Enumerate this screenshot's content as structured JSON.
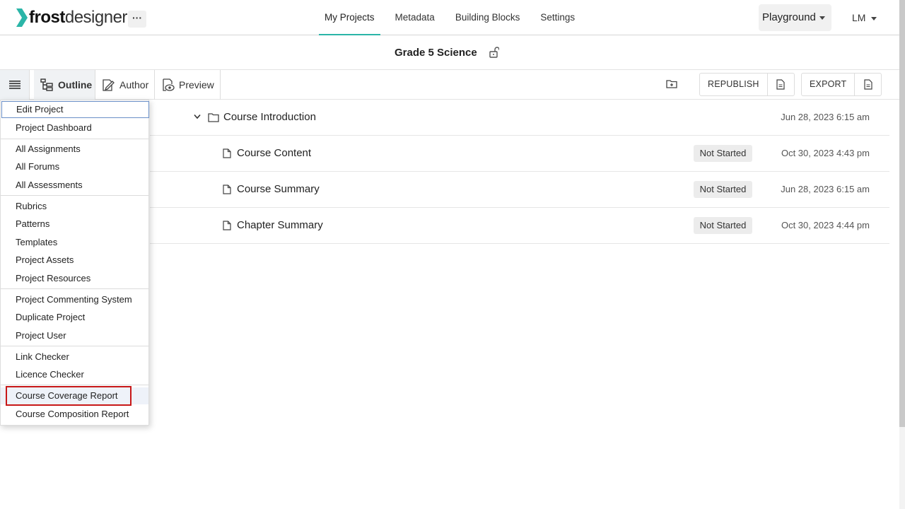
{
  "header": {
    "logo_bold": "frost",
    "logo_light": "designer",
    "more_label": "···",
    "nav": [
      {
        "label": "My Projects"
      },
      {
        "label": "Metadata"
      },
      {
        "label": "Building Blocks"
      },
      {
        "label": "Settings"
      }
    ],
    "workspace": "Playground",
    "user_initials": "LM",
    "accent_color": "#2bb5a8"
  },
  "project": {
    "title": "Grade 5 Science",
    "lock_icon": "unlock-icon"
  },
  "toolbar": {
    "outline_label": "Outline",
    "author_label": "Author",
    "preview_label": "Preview",
    "republish_label": "REPUBLISH",
    "export_label": "EXPORT"
  },
  "outline": {
    "rows": [
      {
        "name": "Course Introduction",
        "status": "",
        "date": "Jun 28, 2023 6:15 am",
        "type": "folder"
      },
      {
        "name": "Course Content",
        "status": "Not Started",
        "date": "Oct 30, 2023 4:43 pm",
        "type": "page"
      },
      {
        "name": "Course Summary",
        "status": "Not Started",
        "date": "Jun 28, 2023 6:15 am",
        "type": "page"
      },
      {
        "name": "Chapter Summary",
        "status": "Not Started",
        "date": "Oct 30, 2023 4:44 pm",
        "type": "page"
      }
    ]
  },
  "menu": {
    "items": [
      {
        "label": "Edit Project"
      },
      {
        "label": "Project Dashboard"
      },
      {
        "label": "All Assignments"
      },
      {
        "label": "All Forums"
      },
      {
        "label": "All Assessments"
      },
      {
        "label": "Rubrics"
      },
      {
        "label": "Patterns"
      },
      {
        "label": "Templates"
      },
      {
        "label": "Project Assets"
      },
      {
        "label": "Project Resources"
      },
      {
        "label": "Project Commenting System"
      },
      {
        "label": "Duplicate Project"
      },
      {
        "label": "Project User"
      },
      {
        "label": "Link Checker"
      },
      {
        "label": "Licence Checker"
      },
      {
        "label": "Course Coverage Report"
      },
      {
        "label": "Course Composition Report"
      }
    ],
    "highlight_color": "#c81818"
  }
}
